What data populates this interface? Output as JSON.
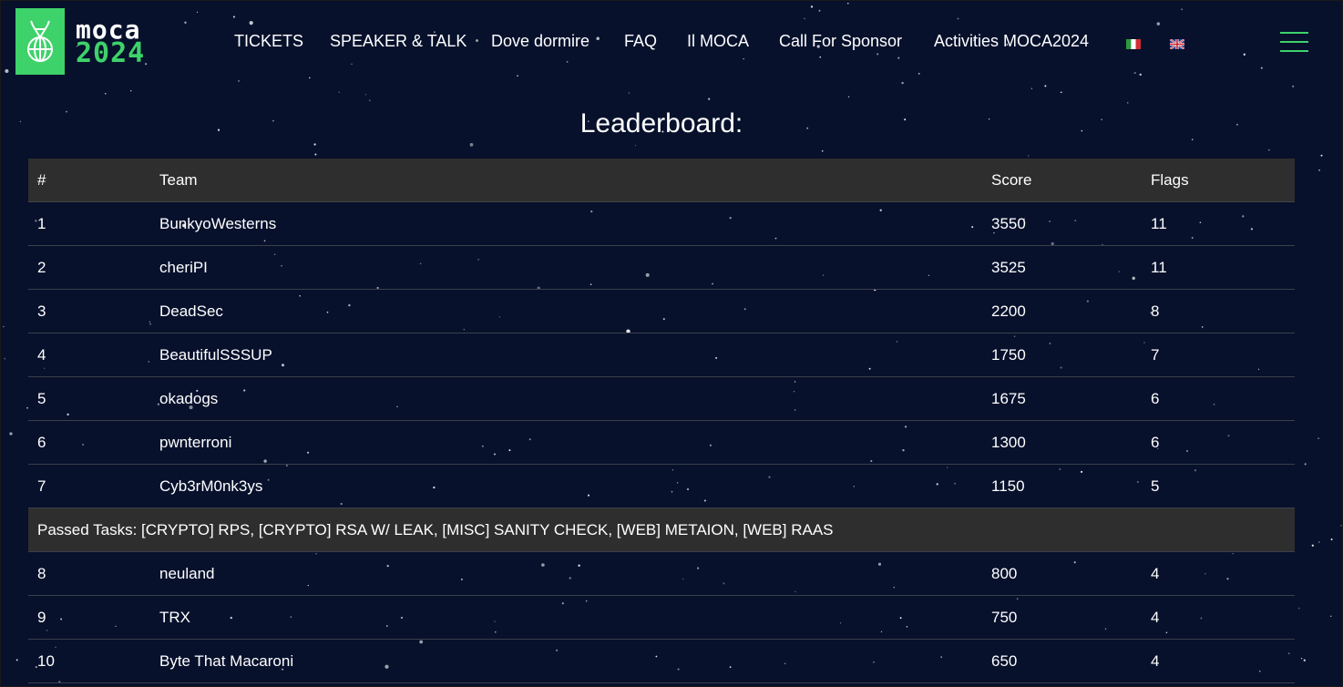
{
  "logo": {
    "line1": "moca",
    "line2": "2024"
  },
  "nav": {
    "items": [
      "TICKETS",
      "SPEAKER & TALK",
      "Dove dormire",
      "FAQ",
      "Il MOCA",
      "Call For Sponsor",
      "Activities MOCA2024"
    ],
    "flags": [
      "italian-flag-icon",
      "uk-flag-icon"
    ]
  },
  "page": {
    "title": "Leaderboard:"
  },
  "table": {
    "headers": {
      "rank": "#",
      "team": "Team",
      "score": "Score",
      "flags": "Flags"
    },
    "rows": [
      {
        "rank": "1",
        "team": "BunkyoWesterns",
        "score": "3550",
        "flags": "11"
      },
      {
        "rank": "2",
        "team": "cheriPI",
        "score": "3525",
        "flags": "11"
      },
      {
        "rank": "3",
        "team": "DeadSec",
        "score": "2200",
        "flags": "8"
      },
      {
        "rank": "4",
        "team": "BeautifulSSSUP",
        "score": "1750",
        "flags": "7"
      },
      {
        "rank": "5",
        "team": "okadogs",
        "score": "1675",
        "flags": "6"
      },
      {
        "rank": "6",
        "team": "pwnterroni",
        "score": "1300",
        "flags": "6"
      },
      {
        "rank": "7",
        "team": "Cyb3rM0nk3ys",
        "score": "1150",
        "flags": "5"
      }
    ],
    "passed_tasks": "Passed Tasks: [CRYPTO] RPS, [CRYPTO] RSA W/ LEAK, [MISC] SANITY CHECK, [WEB] METAION, [WEB] RAAS",
    "rows_after": [
      {
        "rank": "8",
        "team": "neuland",
        "score": "800",
        "flags": "4"
      },
      {
        "rank": "9",
        "team": "TRX",
        "score": "750",
        "flags": "4"
      },
      {
        "rank": "10",
        "team": "Byte That Macaroni",
        "score": "650",
        "flags": "4"
      }
    ]
  },
  "colors": {
    "background": "#07112c",
    "accent": "#3ed26a",
    "header_row": "#2e2e2e"
  }
}
